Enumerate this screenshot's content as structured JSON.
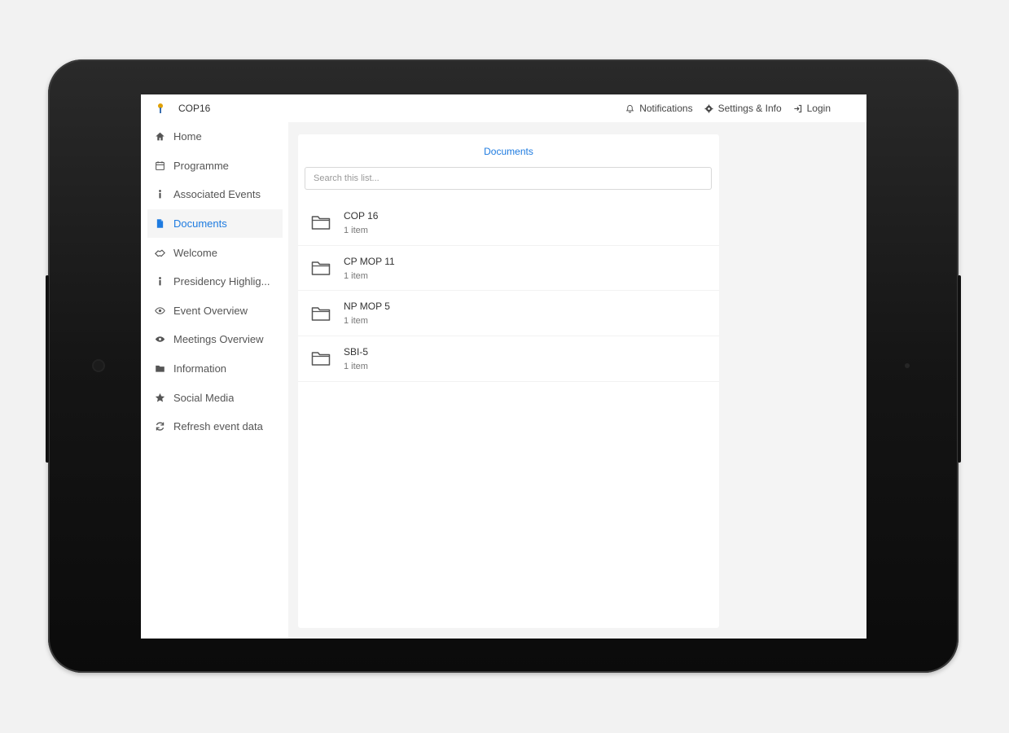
{
  "header": {
    "app_name": "COP16",
    "actions": [
      {
        "label": "Notifications",
        "icon": "bell-icon"
      },
      {
        "label": "Settings & Info",
        "icon": "gear-icon"
      },
      {
        "label": "Login",
        "icon": "login-icon"
      }
    ]
  },
  "sidebar": {
    "items": [
      {
        "label": "Home",
        "icon": "home-icon",
        "active": false
      },
      {
        "label": "Programme",
        "icon": "calendar-icon",
        "active": false
      },
      {
        "label": "Associated Events",
        "icon": "info-icon",
        "active": false
      },
      {
        "label": "Documents",
        "icon": "document-icon",
        "active": true
      },
      {
        "label": "Welcome",
        "icon": "handshake-icon",
        "active": false
      },
      {
        "label": "Presidency Highlig...",
        "icon": "info-icon",
        "active": false
      },
      {
        "label": "Event Overview",
        "icon": "eye-icon",
        "active": false
      },
      {
        "label": "Meetings Overview",
        "icon": "meetings-icon",
        "active": false
      },
      {
        "label": "Information",
        "icon": "folder-icon",
        "active": false
      },
      {
        "label": "Social Media",
        "icon": "star-icon",
        "active": false
      },
      {
        "label": "Refresh event data",
        "icon": "refresh-icon",
        "active": false
      }
    ]
  },
  "main": {
    "title": "Documents",
    "search_placeholder": "Search this list...",
    "folders": [
      {
        "name": "COP 16",
        "count": "1 item"
      },
      {
        "name": "CP MOP 11",
        "count": "1 item"
      },
      {
        "name": "NP MOP 5",
        "count": "1 item"
      },
      {
        "name": "SBI-5",
        "count": "1 item"
      }
    ]
  },
  "colors": {
    "accent": "#1e7be0",
    "background": "#f2f2f2",
    "device": "#1a1a1a"
  }
}
